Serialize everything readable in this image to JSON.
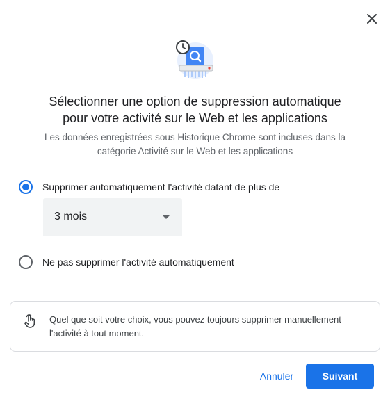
{
  "dialog": {
    "close_icon": "close-icon",
    "hero_icon": "history-search-shredder-illustration",
    "title_line1": "Sélectionner une option de suppression automatique",
    "title_line2": "pour votre activité sur le Web et les applications",
    "subtitle_line1": "Les données enregistrées sous Historique Chrome sont incluses dans la",
    "subtitle_line2": "catégorie Activité sur le Web et les applications"
  },
  "options": [
    {
      "label": "Supprimer automatiquement l'activité datant de plus de",
      "selected": true
    },
    {
      "label": "Ne pas supprimer l'activité automatiquement",
      "selected": false
    }
  ],
  "duration_select": {
    "value": "3 mois"
  },
  "info": {
    "icon": "hand-pointer-icon",
    "text_line1": "Quel que soit votre choix, vous pouvez toujours supprimer manuellement",
    "text_line2": "l'activité à tout moment."
  },
  "footer": {
    "cancel_label": "Annuler",
    "next_label": "Suivant"
  },
  "colors": {
    "accent": "#1a73e8",
    "text_primary": "#202124",
    "text_secondary": "#5f6368",
    "border": "#dadce0",
    "select_bg": "#f1f3f4"
  }
}
